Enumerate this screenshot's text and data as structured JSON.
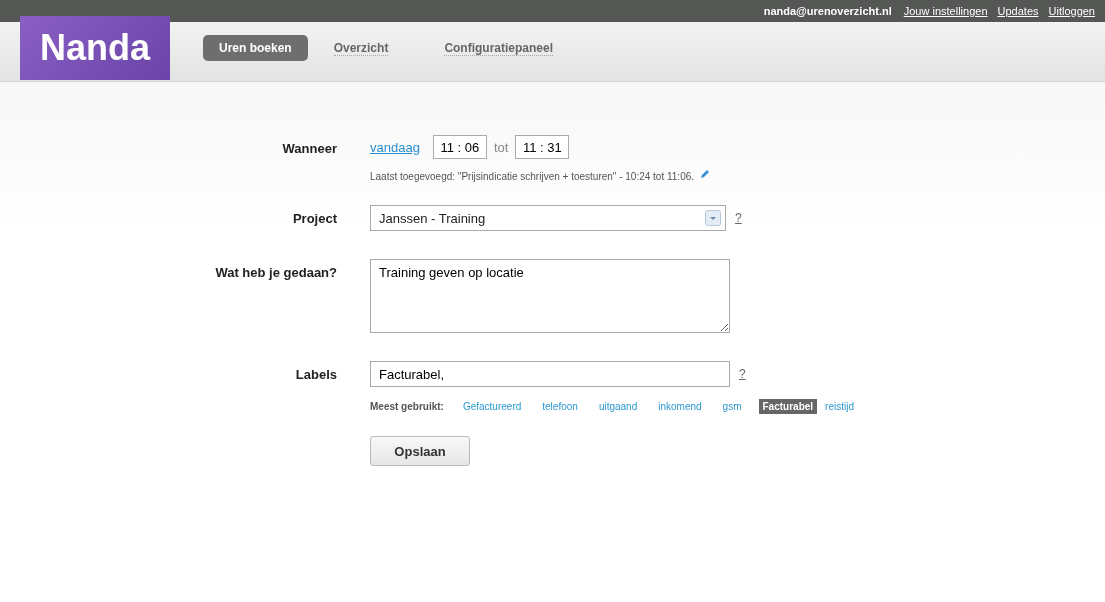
{
  "top_bar": {
    "user": "nanda@urenoverzicht.nl",
    "links": [
      "Jouw instellingen",
      "Updates",
      "Uitloggen"
    ]
  },
  "logo": "Nanda",
  "nav": [
    {
      "label": "Uren boeken",
      "selected": true
    },
    {
      "label": "Overzicht",
      "selected": false
    },
    {
      "label": "Configuratiepaneel",
      "selected": false
    }
  ],
  "form": {
    "when": {
      "label": "Wanneer",
      "day": "vandaag",
      "start": "11 : 06",
      "separator": "tot",
      "end": "11 : 31",
      "note": "Laatst toegevoegd: \"Prijsindicatie schrijven + toesturen\" - 10:24 tot 11:06."
    },
    "project": {
      "label": "Project",
      "value": "Janssen - Training",
      "help": "?"
    },
    "description": {
      "label": "Wat heb je gedaan?",
      "value": "Training geven op locatie"
    },
    "labels": {
      "label": "Labels",
      "value": "Facturabel,",
      "help": "?",
      "most_used_label": "Meest gebruikt:",
      "tags": [
        {
          "label": "Gefactureerd",
          "selected": false
        },
        {
          "label": "telefoon",
          "selected": false
        },
        {
          "label": "uitgaand",
          "selected": false
        },
        {
          "label": "inkomend",
          "selected": false
        },
        {
          "label": "gsm",
          "selected": false
        },
        {
          "label": "Facturabel",
          "selected": true
        },
        {
          "label": "reistijd",
          "selected": false
        }
      ]
    },
    "save_button": "Opslaan"
  }
}
